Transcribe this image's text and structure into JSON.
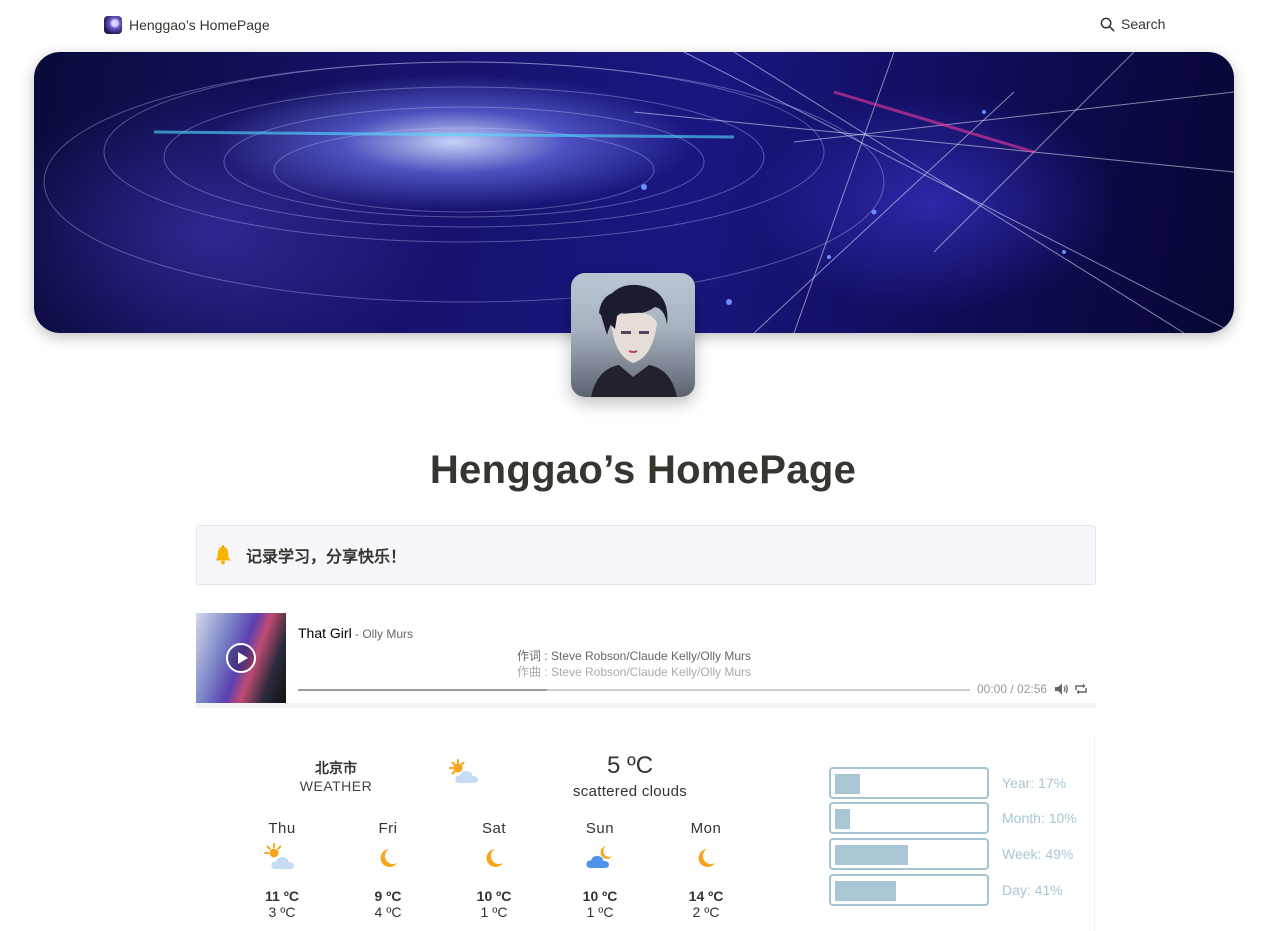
{
  "topbar": {
    "brand": "Henggao’s HomePage",
    "search_label": "Search"
  },
  "page": {
    "title": "Henggao’s HomePage"
  },
  "callout": {
    "icon": "bell-icon",
    "text": "记录学习，分享快乐！"
  },
  "player": {
    "song": "That Girl",
    "artist": " - Olly Murs",
    "lyric_line1": "作词 : Steve Robson/Claude Kelly/Olly Murs",
    "lyric_line2": "作曲 : Steve Robson/Claude Kelly/Olly Murs",
    "time": "00:00 / 02:56",
    "loaded_fraction": 0.37
  },
  "weather": {
    "city": "北京市",
    "label": "WEATHER",
    "current_icon": "sun-cloud-icon",
    "current_temp": "5 ºC",
    "description": "scattered clouds",
    "forecast": [
      {
        "day": "Thu",
        "icon": "sun-cloud-icon",
        "high": "11 ºC",
        "low": "3 ºC"
      },
      {
        "day": "Fri",
        "icon": "moon-icon",
        "high": "9 ºC",
        "low": "4 ºC"
      },
      {
        "day": "Sat",
        "icon": "moon-icon",
        "high": "10 ºC",
        "low": "1 ºC"
      },
      {
        "day": "Sun",
        "icon": "cloud-moon-icon",
        "high": "10 ºC",
        "low": "1 ºC"
      },
      {
        "day": "Mon",
        "icon": "moon-icon",
        "high": "14 ºC",
        "low": "2 ºC"
      }
    ]
  },
  "progress": [
    {
      "label": "Year: 17%",
      "value": 0.17
    },
    {
      "label": "Month: 10%",
      "value": 0.1
    },
    {
      "label": "Week: 49%",
      "value": 0.49
    },
    {
      "label": "Day: 41%",
      "value": 0.41
    }
  ],
  "colors": {
    "accent": "#a9c6d5",
    "text": "#37352f",
    "callout_bg": "#f7f6fb",
    "sun": "#f8a51c",
    "cloud": "#c6dcf5"
  }
}
